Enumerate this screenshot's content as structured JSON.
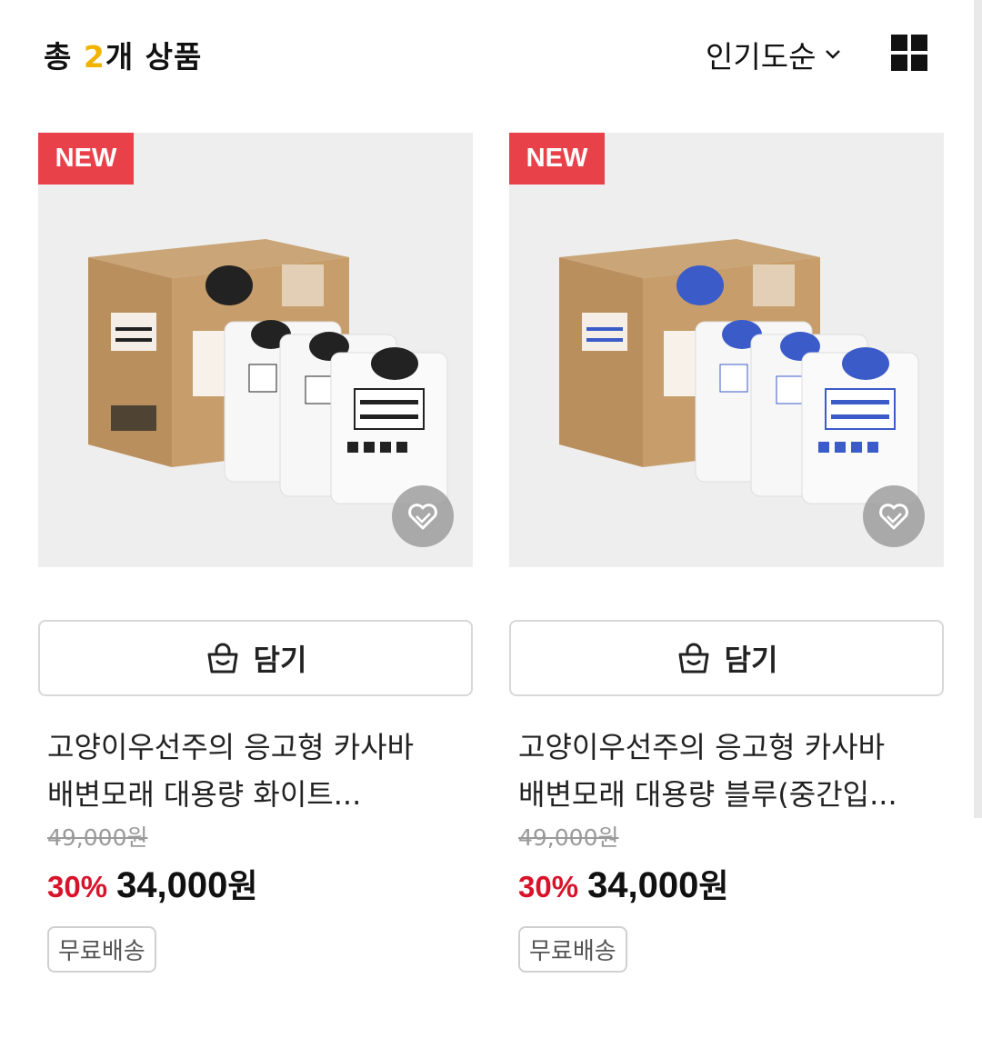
{
  "header": {
    "count_prefix": "총 ",
    "count_number": "2",
    "count_suffix": "개 상품",
    "sort_label": "인기도순",
    "sort_icon": "chevron-down-icon",
    "view_icon": "grid-view-icon"
  },
  "products": [
    {
      "badge": "NEW",
      "image_desc_icon": "cat-litter-box-white",
      "accent": "#111111",
      "cart_label": "담기",
      "title_line1": "고양이우선주의 응고형 카사바",
      "title_line2": "배변모래 대용량 화이트...",
      "original_price": "49,000원",
      "discount_rate": "30%",
      "price": "34,000",
      "price_unit": "원",
      "tag": "무료배송"
    },
    {
      "badge": "NEW",
      "image_desc_icon": "cat-litter-box-blue",
      "accent": "#3b5bc8",
      "cart_label": "담기",
      "title_line1": "고양이우선주의 응고형 카사바",
      "title_line2": "배변모래 대용량 블루(중간입...",
      "original_price": "49,000원",
      "discount_rate": "30%",
      "price": "34,000",
      "price_unit": "원",
      "tag": "무료배송"
    }
  ],
  "colors": {
    "badge": "#e8414a",
    "discount": "#d7142c",
    "count_highlight": "#f0b400"
  }
}
